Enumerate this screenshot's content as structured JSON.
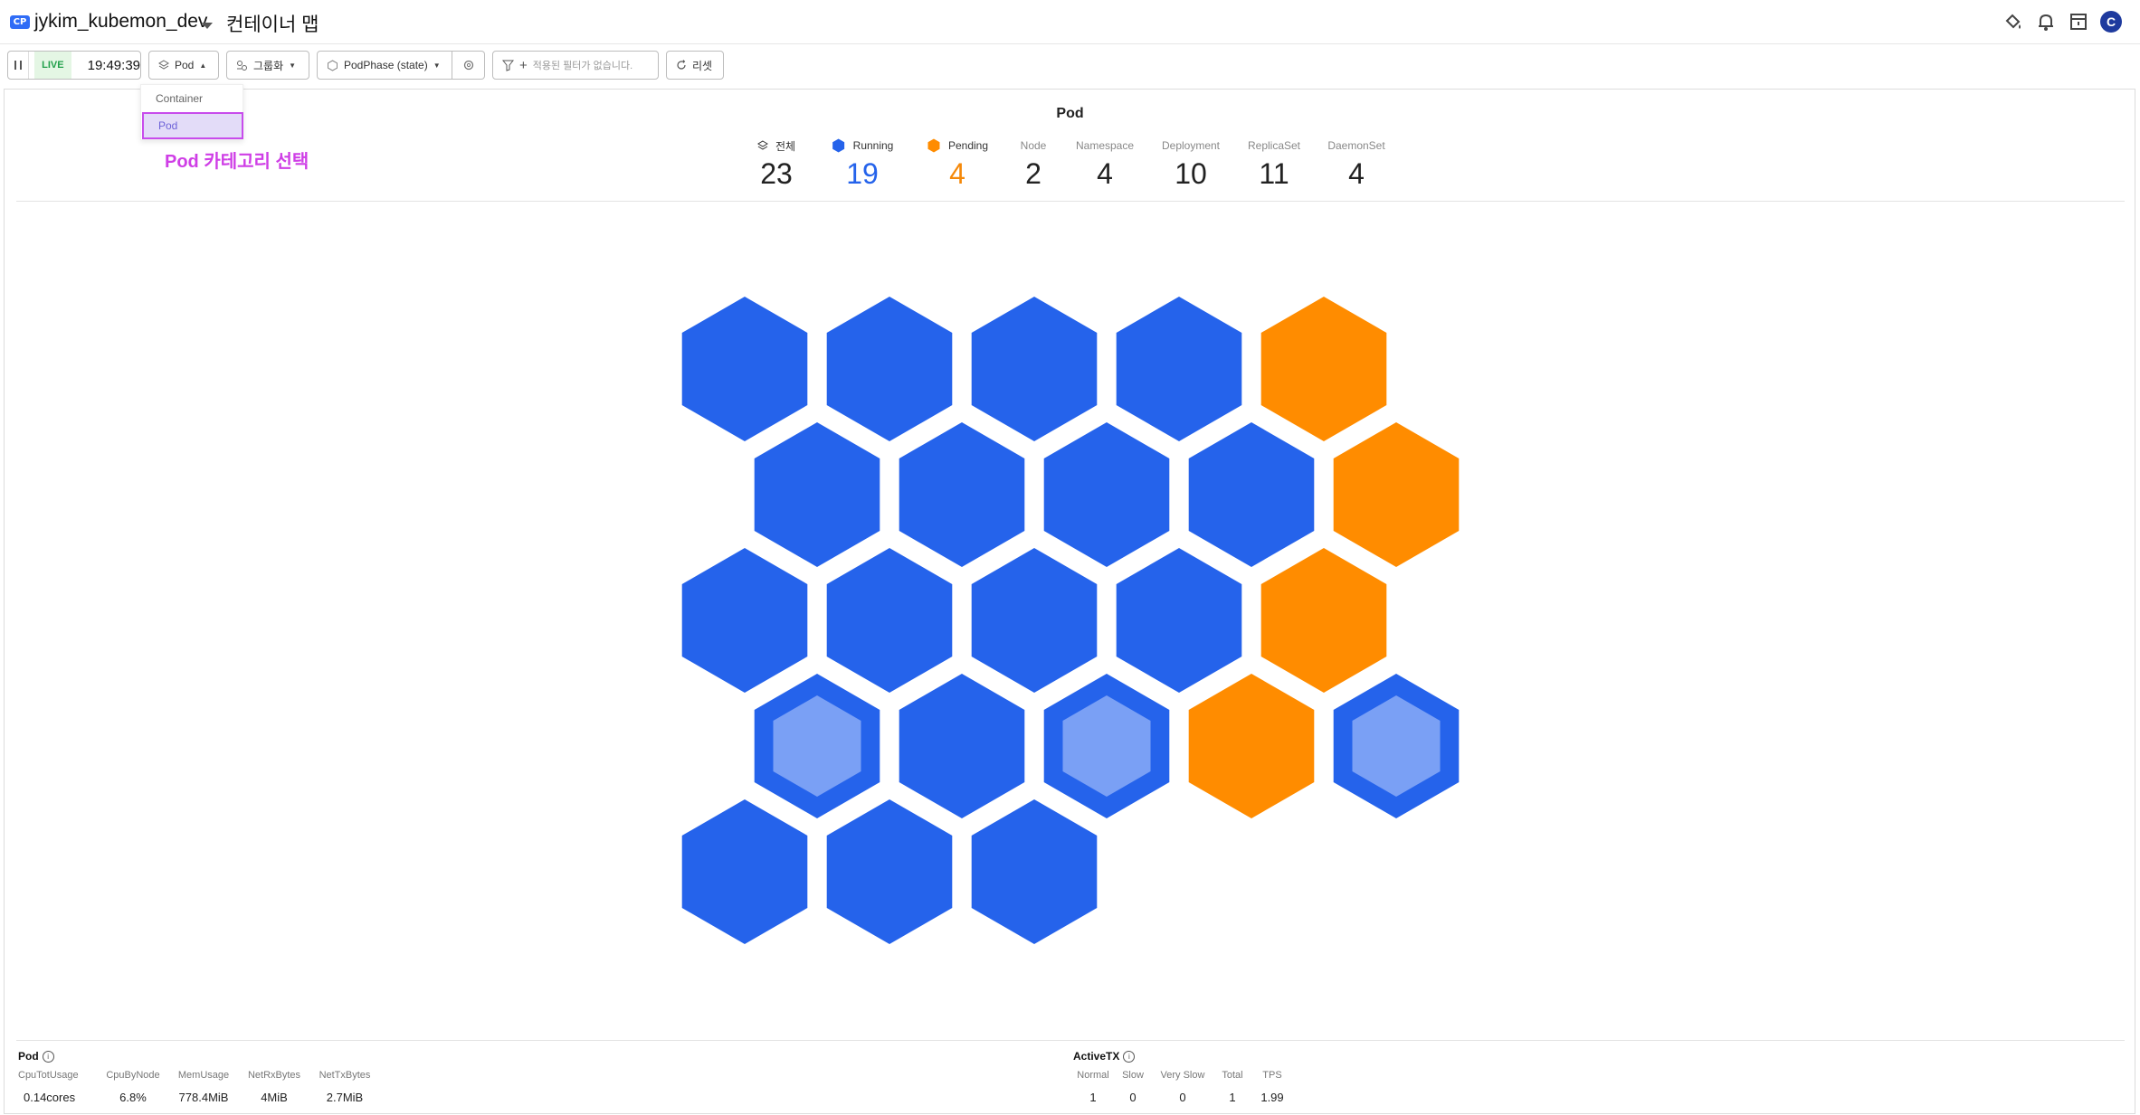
{
  "header": {
    "badge": "CP",
    "project_name": "jykim_kubemon_dev",
    "page_title": "컨테이너 맵",
    "avatar_letter": "C"
  },
  "toolbar": {
    "live_label": "LIVE",
    "time": "19:49:39",
    "category_label": "Pod",
    "group_label": "그룹화",
    "color_by_label": "PodPhase (state)",
    "filter_placeholder": "적용된 필터가 없습니다.",
    "reset_label": "리셋"
  },
  "dropdown": {
    "items": [
      "Container",
      "Pod"
    ],
    "selected": "Pod"
  },
  "annotation": "Pod 카테고리 선택",
  "map": {
    "title": "Pod",
    "stats": [
      {
        "label": "전체",
        "value": "23",
        "icon": "layers-icon"
      },
      {
        "label": "Running",
        "value": "19",
        "color": "#2563eb"
      },
      {
        "label": "Pending",
        "value": "4",
        "color": "#f5890a"
      },
      {
        "label": "Node",
        "value": "2"
      },
      {
        "label": "Namespace",
        "value": "4"
      },
      {
        "label": "Deployment",
        "value": "10"
      },
      {
        "label": "ReplicaSet",
        "value": "11"
      },
      {
        "label": "DaemonSet",
        "value": "4"
      }
    ],
    "colors": {
      "running": "#2563eb",
      "pending": "#ff8c00",
      "inner_highlight": "#7aa0f5"
    },
    "pods": [
      {
        "state": "running"
      },
      {
        "state": "running"
      },
      {
        "state": "running"
      },
      {
        "state": "running"
      },
      {
        "state": "pending"
      },
      {
        "state": "running"
      },
      {
        "state": "running"
      },
      {
        "state": "running"
      },
      {
        "state": "running"
      },
      {
        "state": "pending"
      },
      {
        "state": "running"
      },
      {
        "state": "running"
      },
      {
        "state": "running"
      },
      {
        "state": "running"
      },
      {
        "state": "pending"
      },
      {
        "state": "running",
        "highlight": true
      },
      {
        "state": "running"
      },
      {
        "state": "running",
        "highlight": true
      },
      {
        "state": "pending"
      },
      {
        "state": "running",
        "highlight": true
      },
      {
        "state": "running"
      },
      {
        "state": "running"
      },
      {
        "state": "running"
      }
    ]
  },
  "footer": {
    "pod": {
      "title": "Pod",
      "columns": [
        "CpuTotUsage",
        "CpuByNode",
        "MemUsage",
        "NetRxBytes",
        "NetTxBytes"
      ],
      "values": [
        "0.14cores",
        "6.8%",
        "778.4MiB",
        "4MiB",
        "2.7MiB"
      ]
    },
    "activetx": {
      "title": "ActiveTX",
      "columns": [
        "Normal",
        "Slow",
        "Very Slow",
        "Total",
        "TPS"
      ],
      "values": [
        "1",
        "0",
        "0",
        "1",
        "1.99"
      ]
    }
  }
}
